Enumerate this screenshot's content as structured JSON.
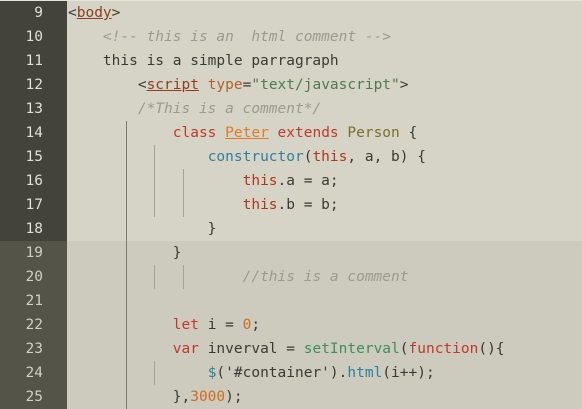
{
  "lines": [
    {
      "n": "9",
      "tokens": [
        {
          "c": "p",
          "t": "<"
        },
        {
          "c": "t",
          "t": "body"
        },
        {
          "c": "p",
          "t": ">"
        }
      ]
    },
    {
      "n": "10",
      "tokens": [
        {
          "c": "p",
          "t": "    "
        },
        {
          "c": "cm",
          "t": "<!-- this is an  html comment -->"
        }
      ]
    },
    {
      "n": "11",
      "tokens": [
        {
          "c": "p",
          "t": "    this is a simple parragraph"
        }
      ]
    },
    {
      "n": "12",
      "tokens": [
        {
          "c": "p",
          "t": "        <"
        },
        {
          "c": "t",
          "t": "script"
        },
        {
          "c": "p",
          "t": " "
        },
        {
          "c": "a",
          "t": "type"
        },
        {
          "c": "p",
          "t": "="
        },
        {
          "c": "s",
          "t": "\"text/javascript\""
        },
        {
          "c": "p",
          "t": ">"
        }
      ]
    },
    {
      "n": "13",
      "tokens": [
        {
          "c": "p",
          "t": "        "
        },
        {
          "c": "cm",
          "t": "/*This is a comment*/"
        }
      ]
    },
    {
      "n": "14",
      "tokens": [
        {
          "c": "p",
          "t": "            "
        },
        {
          "c": "kw",
          "t": "class"
        },
        {
          "c": "p",
          "t": " "
        },
        {
          "c": "cls",
          "t": "Peter"
        },
        {
          "c": "p",
          "t": " "
        },
        {
          "c": "kw",
          "t": "extends"
        },
        {
          "c": "p",
          "t": " "
        },
        {
          "c": "ty",
          "t": "Person"
        },
        {
          "c": "p",
          "t": " {"
        }
      ]
    },
    {
      "n": "15",
      "tokens": [
        {
          "c": "p",
          "t": "                "
        },
        {
          "c": "fn",
          "t": "constructor"
        },
        {
          "c": "p",
          "t": "("
        },
        {
          "c": "k",
          "t": "this"
        },
        {
          "c": "p",
          "t": ", a, b) {"
        }
      ]
    },
    {
      "n": "16",
      "tokens": [
        {
          "c": "p",
          "t": "                    "
        },
        {
          "c": "k",
          "t": "this"
        },
        {
          "c": "p",
          "t": ".a = a;"
        }
      ]
    },
    {
      "n": "17",
      "tokens": [
        {
          "c": "p",
          "t": "                    "
        },
        {
          "c": "k",
          "t": "this"
        },
        {
          "c": "p",
          "t": ".b = b;"
        }
      ]
    },
    {
      "n": "18",
      "tokens": [
        {
          "c": "p",
          "t": "                }"
        }
      ]
    },
    {
      "n": "19",
      "tokens": [
        {
          "c": "p",
          "t": "            }"
        }
      ]
    },
    {
      "n": "20",
      "tokens": [
        {
          "c": "p",
          "t": "                    "
        },
        {
          "c": "cm",
          "t": "//this is a comment"
        }
      ]
    },
    {
      "n": "21",
      "tokens": []
    },
    {
      "n": "22",
      "tokens": [
        {
          "c": "p",
          "t": "            "
        },
        {
          "c": "kw",
          "t": "let"
        },
        {
          "c": "p",
          "t": " i = "
        },
        {
          "c": "num",
          "t": "0"
        },
        {
          "c": "p",
          "t": ";"
        }
      ]
    },
    {
      "n": "23",
      "tokens": [
        {
          "c": "p",
          "t": "            "
        },
        {
          "c": "kw",
          "t": "var"
        },
        {
          "c": "p",
          "t": " inverval = "
        },
        {
          "c": "fn2",
          "t": "setInterval"
        },
        {
          "c": "p",
          "t": "("
        },
        {
          "c": "kw",
          "t": "function"
        },
        {
          "c": "p",
          "t": "(){"
        }
      ]
    },
    {
      "n": "24",
      "tokens": [
        {
          "c": "p",
          "t": "                "
        },
        {
          "c": "fn",
          "t": "$"
        },
        {
          "c": "p",
          "t": "('#container')."
        },
        {
          "c": "fn",
          "t": "html"
        },
        {
          "c": "p",
          "t": "(i++);"
        }
      ]
    },
    {
      "n": "25",
      "tokens": [
        {
          "c": "p",
          "t": "            },"
        },
        {
          "c": "num",
          "t": "3000"
        },
        {
          "c": "p",
          "t": ");"
        }
      ]
    }
  ]
}
